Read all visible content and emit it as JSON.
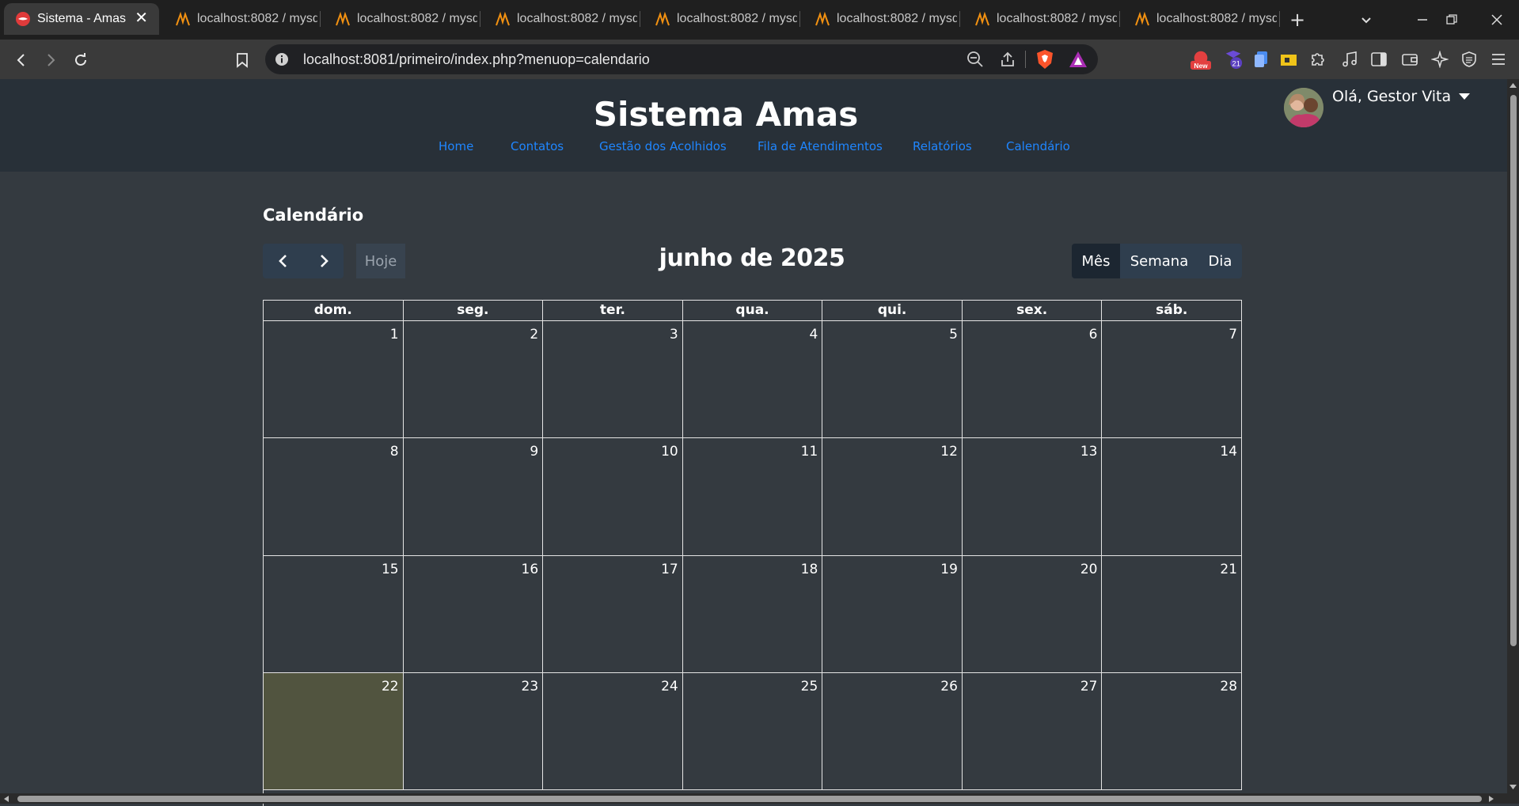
{
  "browser": {
    "tabs": [
      {
        "title": "Sistema - Amas",
        "active": true
      },
      {
        "title": "localhost:8082 / mysq",
        "active": false
      },
      {
        "title": "localhost:8082 / mysq",
        "active": false
      },
      {
        "title": "localhost:8082 / mysq",
        "active": false
      },
      {
        "title": "localhost:8082 / mysq",
        "active": false
      },
      {
        "title": "localhost:8082 / mysq",
        "active": false
      },
      {
        "title": "localhost:8082 / mysq",
        "active": false
      },
      {
        "title": "localhost:8082 / mysq",
        "active": false
      }
    ],
    "url": "localhost:8081/primeiro/index.php?menuop=calendario",
    "extensions": {
      "new_badge": "New",
      "count_badge": "21"
    }
  },
  "header": {
    "title": "Sistema Amas",
    "nav": [
      "Home",
      "Contatos",
      "Gestão dos Acolhidos",
      "Fila de Atendimentos",
      "Relatórios",
      "Calendário"
    ],
    "user_greeting": "Olá, Gestor Vita"
  },
  "calendar": {
    "section_title": "Calendário",
    "heading": "junho de 2025",
    "today_label": "Hoje",
    "views": [
      "Mês",
      "Semana",
      "Dia"
    ],
    "active_view": "Mês",
    "weekdays": [
      "dom.",
      "seg.",
      "ter.",
      "qua.",
      "qui.",
      "sex.",
      "sáb."
    ],
    "weeks": [
      [
        "1",
        "2",
        "3",
        "4",
        "5",
        "6",
        "7"
      ],
      [
        "8",
        "9",
        "10",
        "11",
        "12",
        "13",
        "14"
      ],
      [
        "15",
        "16",
        "17",
        "18",
        "19",
        "20",
        "21"
      ],
      [
        "22",
        "23",
        "24",
        "25",
        "26",
        "27",
        "28"
      ]
    ],
    "today": "22",
    "colors": {
      "today_bg": "#51543f",
      "link": "#1f86ff",
      "button_bg": "#2f3e4e"
    }
  }
}
